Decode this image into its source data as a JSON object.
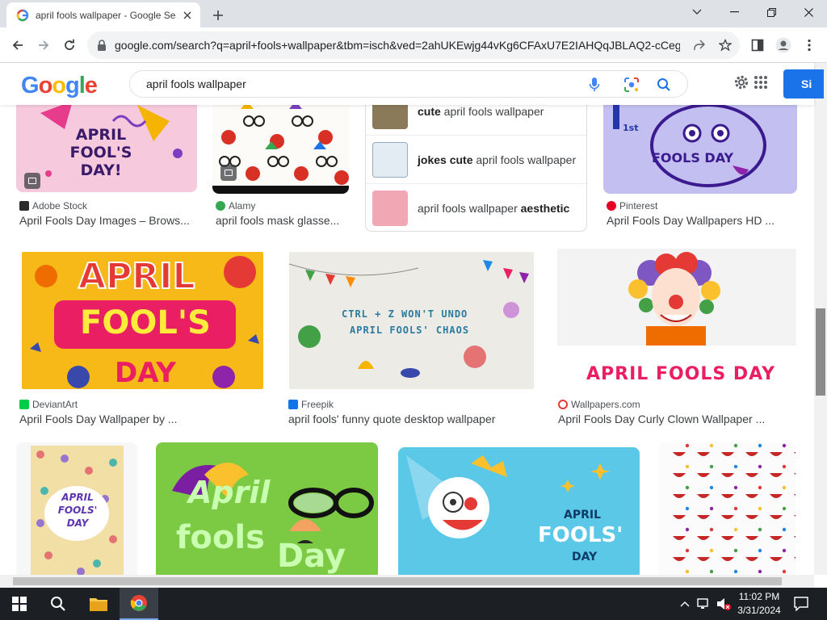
{
  "browser": {
    "tab_title": "april fools wallpaper - Google Se",
    "url": "google.com/search?q=april+fools+wallpaper&tbm=isch&ved=2ahUKEwjg44vKg6CFAxU7E2IAHQqJBLAQ2-cCeg..."
  },
  "google": {
    "logo": "Google",
    "query": "april fools wallpaper",
    "signin_label": "Si"
  },
  "results": {
    "row1": [
      {
        "source": "Adobe Stock",
        "title": "April Fools Day Images – Brows..."
      },
      {
        "source": "Alamy",
        "title": "april fools mask glasse..."
      },
      {
        "source": "Pinterest",
        "title": "April Fools Day Wallpapers HD ..."
      }
    ],
    "row2": [
      {
        "source": "DeviantArt",
        "title": "April Fools Day Wallpaper by ..."
      },
      {
        "source": "Freepik",
        "title": "april fools' funny quote desktop wallpaper"
      },
      {
        "source": "Wallpapers.com",
        "title": "April Fools Day Curly Clown Wallpaper ..."
      }
    ]
  },
  "related": [
    {
      "bold": "cute",
      "rest": " april fools wallpaper"
    },
    {
      "bold": "jokes cute",
      "rest": " april fools wallpaper"
    },
    {
      "plain": "april fools wallpaper ",
      "bold": "aesthetic"
    }
  ],
  "thumb_text": {
    "adobe": "APRIL FOOL'S DAY!",
    "pinterest_1st": "1st",
    "pinterest_main": "FOOLS DAY",
    "deviant_1": "APRIL",
    "deviant_2": "FOOL'S",
    "deviant_3": "DAY",
    "freepik_1": "CTRL + Z WON'T UNDO",
    "freepik_2": "APRIL FOOLS' CHAOS",
    "clown_caption": "APRIL FOOLS DAY",
    "confetti": "APRIL FOOLS' DAY",
    "green_1": "April",
    "green_2": "fools",
    "green_3": "Day",
    "cyan_1": "APRIL",
    "cyan_2": "FOOLS'",
    "cyan_3": "DAY"
  },
  "taskbar": {
    "time": "11:02 PM",
    "date": "3/31/2024"
  },
  "colors": {
    "google_blue": "#4285F4",
    "google_red": "#EA4335",
    "google_yellow": "#FBBC05",
    "google_green": "#34A853",
    "signin_blue": "#1a73e8"
  }
}
